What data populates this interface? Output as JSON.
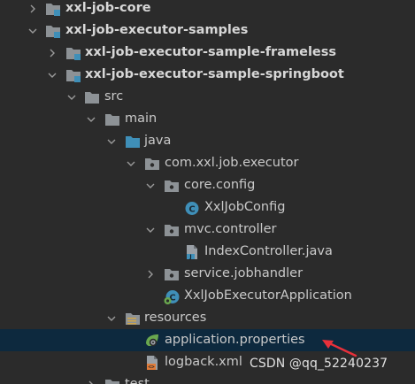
{
  "project_tree": {
    "items": [
      {
        "label": "xxl-job-core"
      },
      {
        "label": "xxl-job-executor-samples"
      },
      {
        "label": "xxl-job-executor-sample-frameless"
      },
      {
        "label": "xxl-job-executor-sample-springboot"
      },
      {
        "label": "src"
      },
      {
        "label": "main"
      },
      {
        "label": "java"
      },
      {
        "label": "com.xxl.job.executor"
      },
      {
        "label": "core.config"
      },
      {
        "label": "XxlJobConfig",
        "icon_letter": "C"
      },
      {
        "label": "mvc.controller"
      },
      {
        "label": "IndexController.java"
      },
      {
        "label": "service.jobhandler"
      },
      {
        "label": "XxlJobExecutorApplication"
      },
      {
        "label": "resources"
      },
      {
        "label": "application.properties"
      },
      {
        "label": "logback.xml"
      },
      {
        "label": "test"
      }
    ],
    "selected_item": "application.properties"
  },
  "watermark": {
    "text": "CSDN @qq_52240237"
  },
  "colors": {
    "background": "#2b2b2b",
    "selection": "#0d293e",
    "annotation_arrow": "#e8303a",
    "folder": "#8d9296",
    "source_folder": "#3f8fb8",
    "class_icon": "#3f8fb8"
  }
}
